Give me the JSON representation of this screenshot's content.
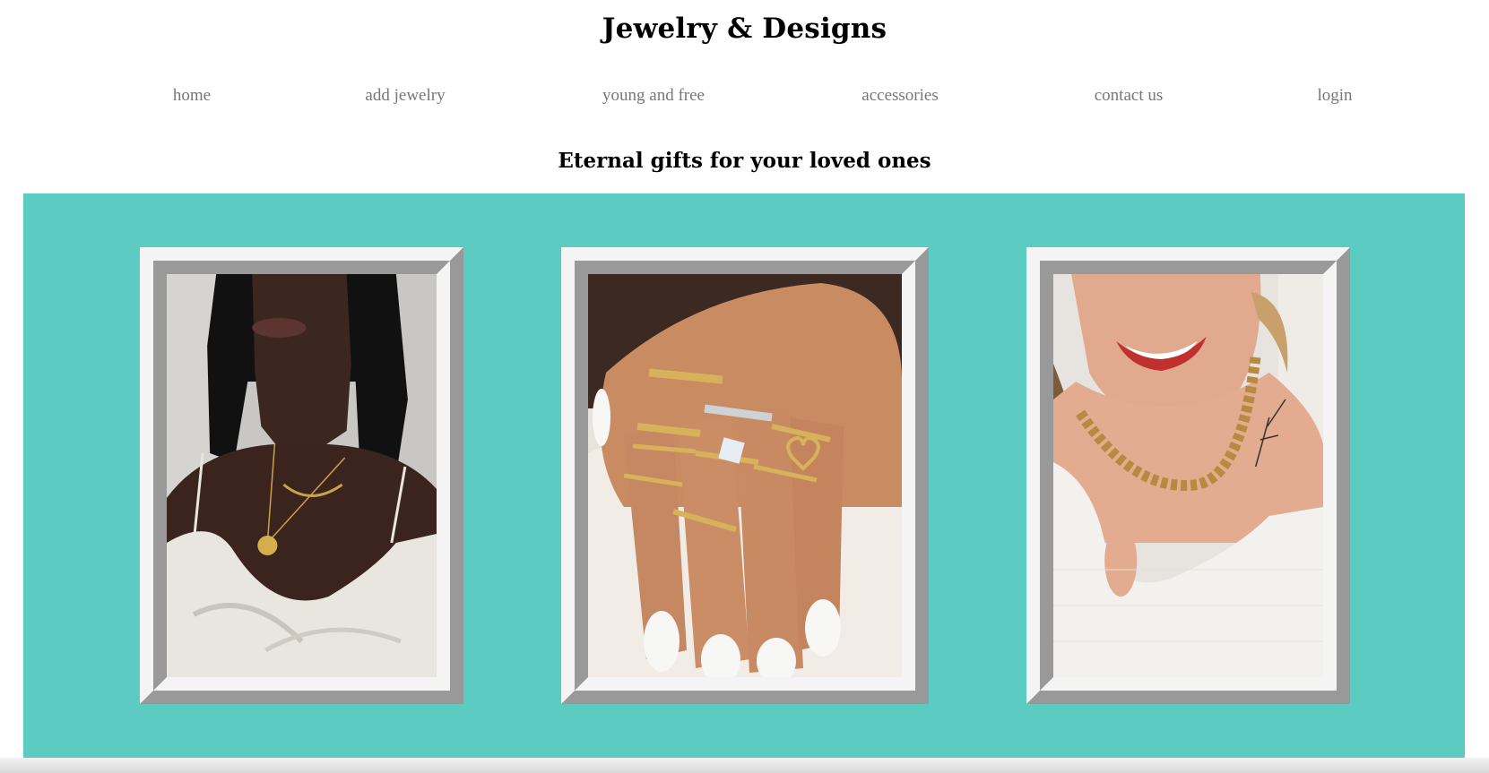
{
  "site": {
    "title": "Jewelry & Designs",
    "tagline": "Eternal gifts for your loved ones"
  },
  "nav": {
    "items": [
      {
        "label": "home"
      },
      {
        "label": "add jewelry"
      },
      {
        "label": "young and free"
      },
      {
        "label": "accessories"
      },
      {
        "label": "contact us"
      },
      {
        "label": "login"
      }
    ]
  },
  "gallery": {
    "background_color": "#5ccbc1",
    "frame_light_color": "#f4f4f4",
    "frame_dark_color": "#999999",
    "photos": [
      {
        "subject": "woman wearing gold chain necklaces with coin pendant and white satin top"
      },
      {
        "subject": "hand with many stacked gold rings and white nails"
      },
      {
        "subject": "smiling woman wearing chunky gold curb chain necklace and white tank top"
      }
    ]
  }
}
